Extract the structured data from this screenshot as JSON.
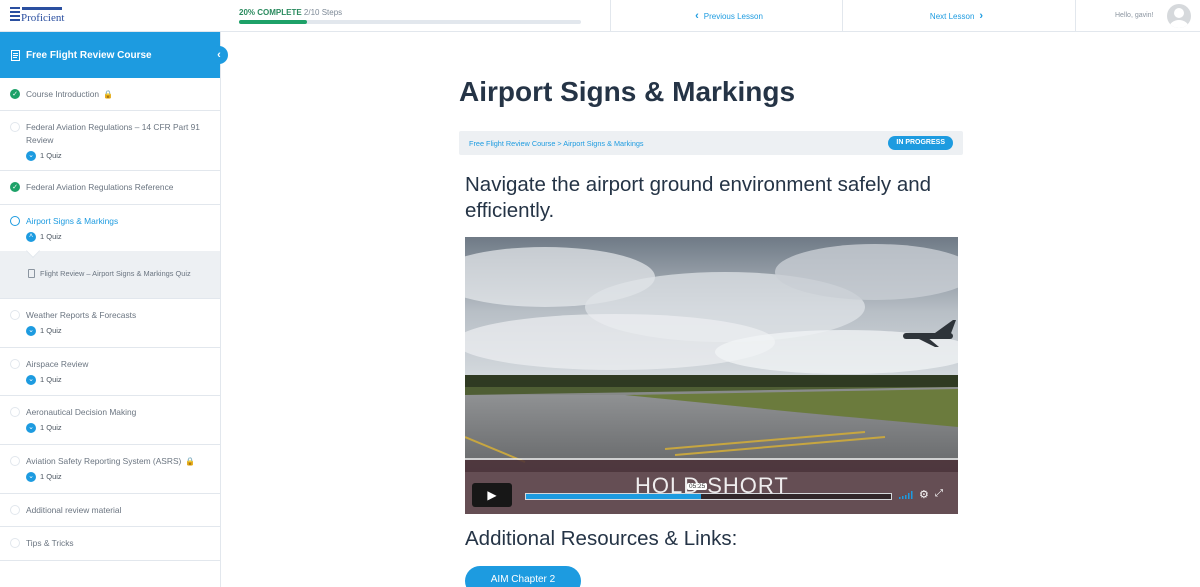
{
  "app": {
    "logo_text": "Proficient",
    "brand_color": "#1d9be0"
  },
  "topbar": {
    "progress_percent_label": "20% COMPLETE",
    "progress_steps": "2/10 Steps",
    "progress_fraction": 0.2,
    "prev_label": "Previous Lesson",
    "next_label": "Next Lesson",
    "greeting": "Hello, gavin!"
  },
  "sidebar": {
    "course_title": "Free Flight Review Course",
    "items": [
      {
        "title": "Course Introduction",
        "status": "done",
        "locked": true
      },
      {
        "title": "Federal Aviation Regulations – 14 CFR Part 91 Review",
        "status": "empty",
        "quiz": "1 Quiz"
      },
      {
        "title": "Federal Aviation Regulations Reference",
        "status": "done"
      },
      {
        "title": "Airport Signs & Markings",
        "status": "current",
        "quiz": "1 Quiz",
        "sub": "Flight Review – Airport Signs & Markings Quiz"
      },
      {
        "title": "Weather Reports & Forecasts",
        "status": "empty",
        "quiz": "1 Quiz"
      },
      {
        "title": "Airspace Review",
        "status": "empty",
        "quiz": "1 Quiz"
      },
      {
        "title": "Aeronautical Decision Making",
        "status": "empty",
        "quiz": "1 Quiz"
      },
      {
        "title": "Aviation Safety Reporting System (ASRS)",
        "status": "empty",
        "quiz": "1 Quiz",
        "locked": true
      },
      {
        "title": "Additional review material",
        "status": "empty"
      },
      {
        "title": "Tips & Tricks",
        "status": "empty"
      }
    ]
  },
  "main": {
    "title": "Airport Signs & Markings",
    "breadcrumb": "Free Flight Review Course > Airport Signs & Markings",
    "badge": "IN PROGRESS",
    "subtitle": "Navigate the airport ground environment safely and efficiently.",
    "video": {
      "overlay_text": "HOLD SHORT",
      "time_tooltip": "05:25",
      "played_fraction": 0.48
    },
    "resources_heading": "Additional Resources & Links:",
    "resource_button": "AIM Chapter 2"
  }
}
